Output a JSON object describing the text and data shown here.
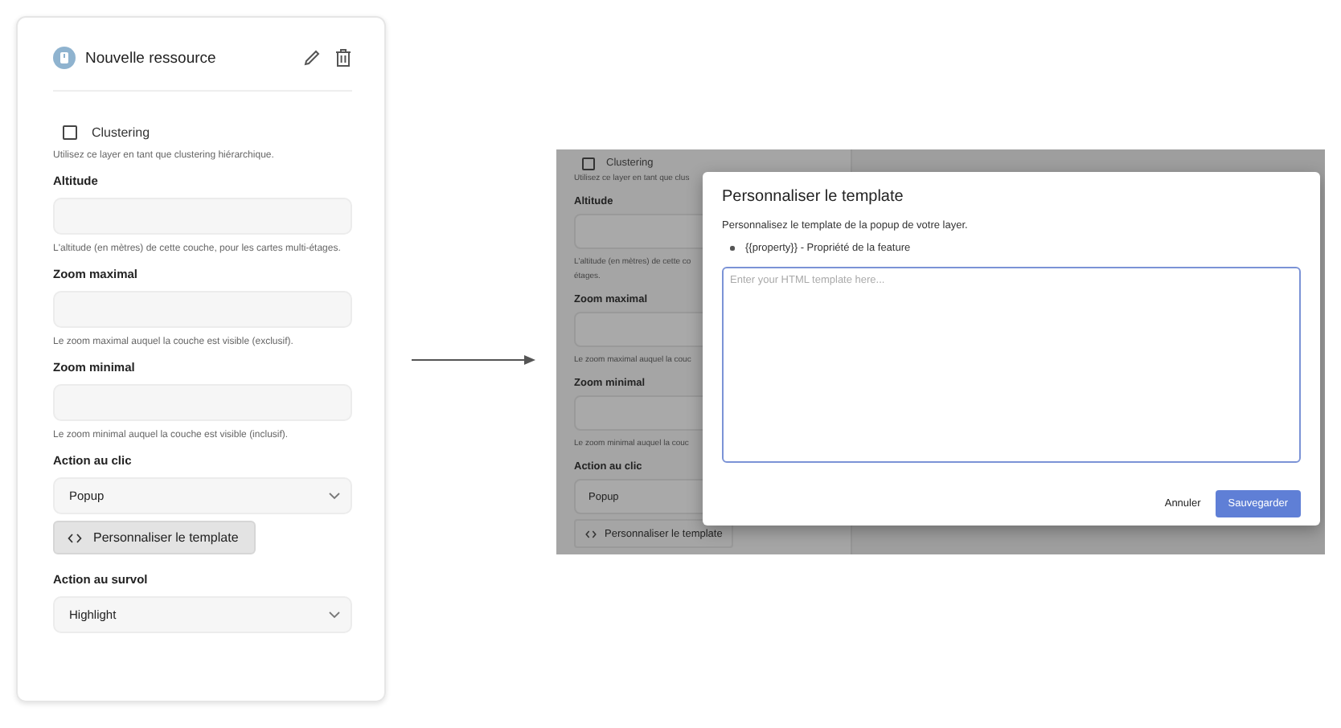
{
  "panel": {
    "title": "Nouvelle ressource",
    "clustering": {
      "label": "Clustering",
      "checked": false,
      "help": "Utilisez ce layer en tant que clustering hiérarchique."
    },
    "fields": [
      {
        "kind": "input",
        "label": "Altitude",
        "help": "L'altitude (en mètres) de cette couche, pour les cartes multi-étages."
      },
      {
        "kind": "input",
        "label": "Zoom maximal",
        "help": "Le zoom maximal auquel la couche est visible (exclusif)."
      },
      {
        "kind": "input",
        "label": "Zoom minimal",
        "help": "Le zoom minimal auquel la couche est visible (inclusif)."
      },
      {
        "kind": "select",
        "label": "Action au clic",
        "value": "Popup"
      },
      {
        "kind": "button",
        "label": "Personnaliser le template"
      },
      {
        "kind": "select",
        "label": "Action au survol",
        "value": "Highlight"
      }
    ]
  },
  "preview": {
    "background_panel": {
      "clustering": {
        "label": "Clustering",
        "checked": false,
        "help_lines": [
          "Utilisez ce layer en tant que clus"
        ]
      },
      "fields": [
        {
          "kind": "input",
          "label": "Altitude",
          "help_lines": [
            "L'altitude (en mètres) de cette co",
            "étages."
          ]
        },
        {
          "kind": "input",
          "label": "Zoom maximal",
          "help_lines": [
            "Le zoom maximal auquel la couc"
          ]
        },
        {
          "kind": "input",
          "label": "Zoom minimal",
          "help_lines": [
            "Le zoom minimal auquel la couc"
          ]
        },
        {
          "kind": "select",
          "label": "Action au clic",
          "value": "Popup"
        },
        {
          "kind": "button",
          "label": "Personnaliser le template"
        }
      ]
    },
    "dialog": {
      "title": "Personnaliser le template",
      "description": "Personnalisez le template de la popup de votre layer.",
      "bullets": [
        "{{property}} - Propriété de la feature"
      ],
      "textarea_placeholder": "Enter your HTML template here...",
      "buttons": [
        {
          "label": "Annuler",
          "kind": "text"
        },
        {
          "label": "Sauvegarder",
          "kind": "primary"
        }
      ]
    }
  }
}
